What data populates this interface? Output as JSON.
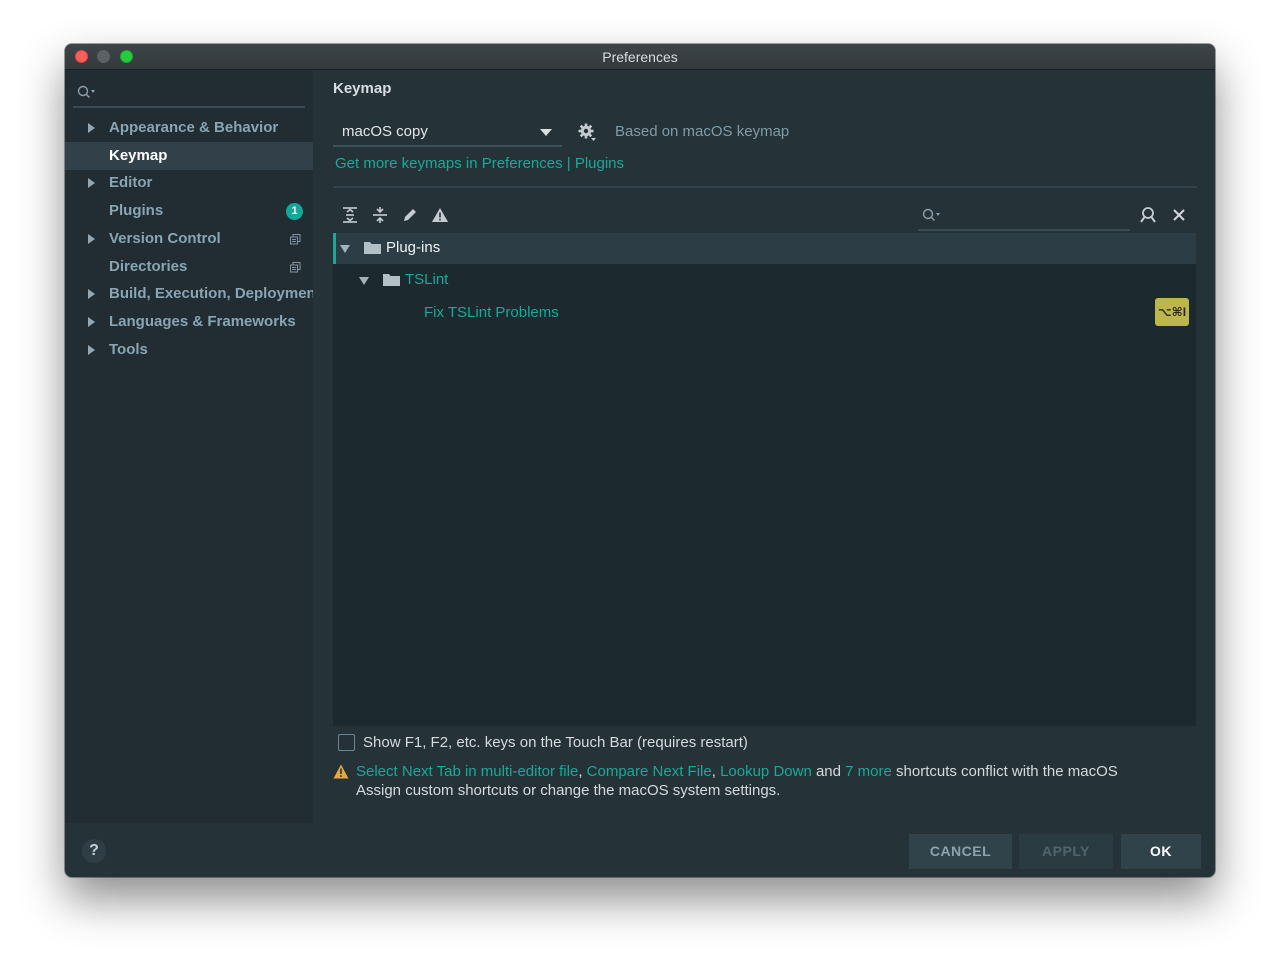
{
  "window": {
    "title": "Preferences"
  },
  "sidebar": {
    "search_placeholder": "",
    "items": [
      {
        "label": "Appearance & Behavior",
        "expandable": true
      },
      {
        "label": "Keymap",
        "selected": true
      },
      {
        "label": "Editor",
        "expandable": true
      },
      {
        "label": "Plugins",
        "badge": "1"
      },
      {
        "label": "Version Control",
        "expandable": true,
        "icon": "copy-icon"
      },
      {
        "label": "Directories",
        "icon": "copy-icon"
      },
      {
        "label": "Build, Execution, Deployment",
        "expandable": true
      },
      {
        "label": "Languages & Frameworks",
        "expandable": true
      },
      {
        "label": "Tools",
        "expandable": true
      }
    ]
  },
  "main": {
    "title": "Keymap",
    "keymap_select": "macOS copy",
    "based_on": "Based on macOS keymap",
    "get_more": {
      "text": "Get more keymaps in Preferences",
      "sep": " | ",
      "plugins": "Plugins"
    },
    "toolbar_icons": [
      "expand-all-icon",
      "collapse-all-icon",
      "edit-icon",
      "warning-icon"
    ],
    "tree": {
      "root": "Plug-ins",
      "child": "TSLint",
      "action": "Fix TSLint Problems",
      "shortcut": "⌥⌘I"
    },
    "touchbar_label": "Show F1, F2, etc. keys on the Touch Bar (requires restart)",
    "conflict": {
      "link1": "Select Next Tab in multi-editor file",
      "sep1": ", ",
      "link2": "Compare Next File",
      "sep2": ", ",
      "link3": "Lookup Down",
      "and": " and ",
      "link4": "7 more",
      "tail": " shortcuts conflict with the macOS",
      "line2": "Assign custom shortcuts or change the macOS system settings."
    }
  },
  "footer": {
    "help": "?",
    "cancel": "CANCEL",
    "apply": "APPLY",
    "ok": "OK"
  },
  "colors": {
    "accent": "#18a99a",
    "background": "#253238",
    "sidebar": "#212d33",
    "shortcut": "#bdb64a"
  }
}
